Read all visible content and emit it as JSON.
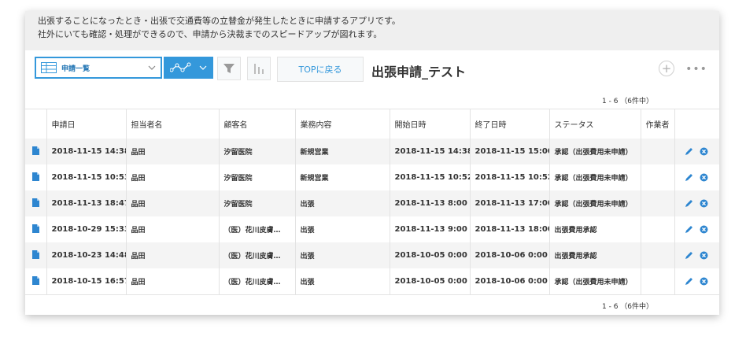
{
  "description": {
    "line1": "出張することになったとき・出張で交通費等の立替金が発生したときに申請するアプリです。",
    "line2": "社外にいても確認・処理ができるので、申請から決裁までのスピードアップが図れます。"
  },
  "toolbar": {
    "view_label": "申請一覧",
    "top_button": "TOPに戻る",
    "app_title": "出張申請_テスト",
    "plus": "+",
    "more": "•••"
  },
  "pager": {
    "top": "1 - 6 （6件中）",
    "bottom": "1 - 6 （6件中）"
  },
  "colors": {
    "accent": "#3498db",
    "link": "#2e86d0",
    "header_bg": "#efefef"
  },
  "table": {
    "headers": [
      "申請日",
      "担当者名",
      "顧客名",
      "業務内容",
      "開始日時",
      "終了日時",
      "ステータス",
      "作業者"
    ],
    "rows": [
      {
        "applied": "2018-11-15 14:38",
        "person": "品田",
        "customer": "汐留医院",
        "work": "新規営業",
        "start": "2018-11-15 14:38",
        "end": "2018-11-15 15:00",
        "status": "承認（出張費用未申請）",
        "worker": ""
      },
      {
        "applied": "2018-11-15 10:53",
        "person": "品田",
        "customer": "汐留医院",
        "work": "新規営業",
        "start": "2018-11-15 10:52",
        "end": "2018-11-15 10:52",
        "status": "承認（出張費用未申請）",
        "worker": ""
      },
      {
        "applied": "2018-11-13 18:47",
        "person": "品田",
        "customer": "汐留医院",
        "work": "出張",
        "start": "2018-11-13 8:00",
        "end": "2018-11-13 17:00",
        "status": "承認（出張費用未申請）",
        "worker": ""
      },
      {
        "applied": "2018-10-29 15:33",
        "person": "品田",
        "customer": "（医）花川皮膚…",
        "work": "出張",
        "start": "2018-11-13 9:00",
        "end": "2018-11-13 18:00",
        "status": "出張費用承認",
        "worker": ""
      },
      {
        "applied": "2018-10-23 14:48",
        "person": "品田",
        "customer": "（医）花川皮膚…",
        "work": "出張",
        "start": "2018-10-05 0:00",
        "end": "2018-10-06 0:00",
        "status": "出張費用承認",
        "worker": ""
      },
      {
        "applied": "2018-10-15 16:57",
        "person": "品田",
        "customer": "（医）花川皮膚…",
        "work": "出張",
        "start": "2018-10-05 0:00",
        "end": "2018-10-06 0:00",
        "status": "承認（出張費用未申請）",
        "worker": ""
      }
    ]
  }
}
